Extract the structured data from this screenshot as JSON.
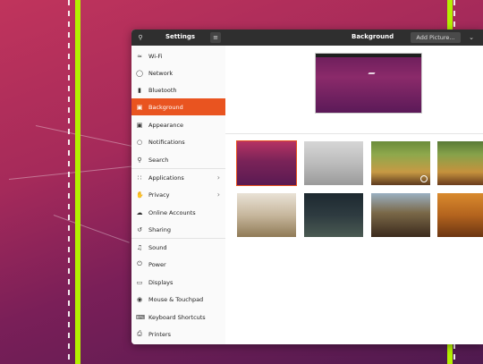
{
  "header": {
    "settings_title": "Settings",
    "panel_title": "Background",
    "add_picture_label": "Add Picture..."
  },
  "sidebar": {
    "items": [
      {
        "label": "Wi-Fi",
        "icon": "wifi-icon"
      },
      {
        "label": "Network",
        "icon": "network-icon"
      },
      {
        "label": "Bluetooth",
        "icon": "bluetooth-icon"
      },
      {
        "label": "Background",
        "icon": "background-icon"
      },
      {
        "label": "Appearance",
        "icon": "appearance-icon"
      },
      {
        "label": "Notifications",
        "icon": "bell-icon"
      },
      {
        "label": "Search",
        "icon": "search-icon"
      },
      {
        "label": "Applications",
        "icon": "grid-icon"
      },
      {
        "label": "Privacy",
        "icon": "hand-icon"
      },
      {
        "label": "Online Accounts",
        "icon": "cloud-icon"
      },
      {
        "label": "Sharing",
        "icon": "share-icon"
      },
      {
        "label": "Sound",
        "icon": "music-icon"
      },
      {
        "label": "Power",
        "icon": "power-icon"
      },
      {
        "label": "Displays",
        "icon": "display-icon"
      },
      {
        "label": "Mouse & Touchpad",
        "icon": "mouse-icon"
      },
      {
        "label": "Keyboard Shortcuts",
        "icon": "keyboard-icon"
      },
      {
        "label": "Printers",
        "icon": "printer-icon"
      }
    ],
    "active": "Background"
  },
  "wallpapers": [
    {
      "name": "ubuntu-purple",
      "selected": true
    },
    {
      "name": "grey-mist",
      "selected": false
    },
    {
      "name": "forest-road",
      "selected": false,
      "timed": true
    },
    {
      "name": "forest-path",
      "selected": false
    },
    {
      "name": "desk-items",
      "selected": false
    },
    {
      "name": "dark-alley",
      "selected": false
    },
    {
      "name": "wooden-bridge",
      "selected": false
    },
    {
      "name": "orange-abstract",
      "selected": false
    }
  ],
  "colors": {
    "accent": "#e95420",
    "headerbar": "#2f2f2f",
    "desktop_guide": "#b4f000"
  }
}
